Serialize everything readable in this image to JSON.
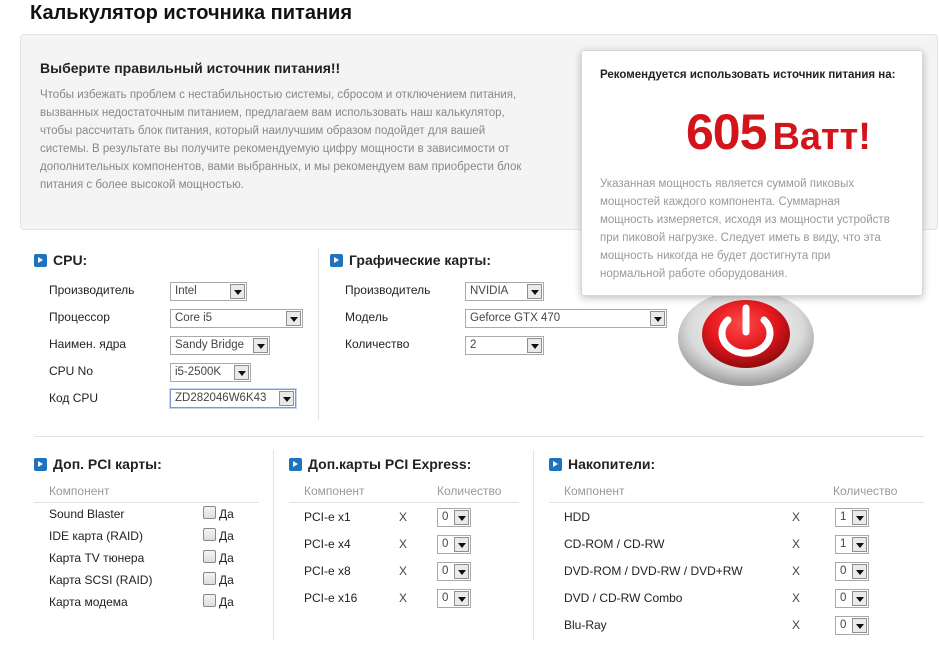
{
  "page_title": "Калькулятор источника питания",
  "intro": {
    "heading": "Выберите правильный источник питания!!",
    "lines": [
      "Чтобы избежать проблем с нестабильностью системы, сбросом и отключением питания,",
      "вызванных недостаточным питанием, предлагаем вам использовать наш калькулятор,",
      "чтобы рассчитать блок питания, который наилучшим образом подойдет для вашей",
      "системы. В результате вы получите рекомендуемую цифру мощности в зависимости от",
      "дополнительных компонентов, вами выбранных, и мы рекомендуем вам приобрести блок",
      "питания с более высокой мощностью."
    ]
  },
  "recommendation": {
    "title": "Рекомендуется использовать источник питания на:",
    "watts": "605",
    "unit": "Ватт!",
    "note_lines": [
      "Указанная мощность является суммой пиковых",
      "мощностей каждого компонента. Суммарная",
      "мощность измеряется, исходя из мощности устройств",
      "при пиковой нагрузке. Следует иметь в виду, что эта",
      "мощность никогда не будет достигнута при",
      "нормальной работе оборудования."
    ],
    "accent_color": "#d4141b"
  },
  "cpu": {
    "heading": "CPU:",
    "rows": [
      {
        "label": "Производитель",
        "value": "Intel"
      },
      {
        "label": "Процессор",
        "value": "Core i5"
      },
      {
        "label": "Наимен. ядра",
        "value": "Sandy Bridge"
      },
      {
        "label": "CPU No",
        "value": "i5-2500K"
      },
      {
        "label": "Код CPU",
        "value": "ZD282046W6K43"
      }
    ]
  },
  "gpu": {
    "heading": "Графические карты:",
    "rows": [
      {
        "label": "Производитель",
        "value": "NVIDIA"
      },
      {
        "label": "Модель",
        "value": "Geforce GTX 470"
      },
      {
        "label": "Количество",
        "value": "2"
      }
    ]
  },
  "pci": {
    "heading": "Доп. PCI карты:",
    "col_component": "Компонент",
    "check_label": "Да",
    "items": [
      "Sound Blaster",
      "IDE карта (RAID)",
      "Карта TV тюнера",
      "Карта SCSI (RAID)",
      "Карта модема"
    ]
  },
  "pcie": {
    "heading": "Доп.карты PCI Express:",
    "col_component": "Компонент",
    "col_qty": "Количество",
    "x": "X",
    "items": [
      {
        "name": "PCI-e x1",
        "qty": "0"
      },
      {
        "name": "PCI-e x4",
        "qty": "0"
      },
      {
        "name": "PCI-e x8",
        "qty": "0"
      },
      {
        "name": "PCI-e x16",
        "qty": "0"
      }
    ]
  },
  "storage": {
    "heading": "Накопители:",
    "col_component": "Компонент",
    "col_qty": "Количество",
    "x": "X",
    "items": [
      {
        "name": "HDD",
        "qty": "1"
      },
      {
        "name": "CD-ROM / CD-RW",
        "qty": "1"
      },
      {
        "name": "DVD-ROM / DVD-RW / DVD+RW",
        "qty": "0"
      },
      {
        "name": "DVD / CD-RW Combo",
        "qty": "0"
      },
      {
        "name": "Blu-Ray",
        "qty": "0"
      }
    ]
  },
  "icons": {
    "section_arrow": "arrow-right-icon",
    "power": "power-icon"
  }
}
